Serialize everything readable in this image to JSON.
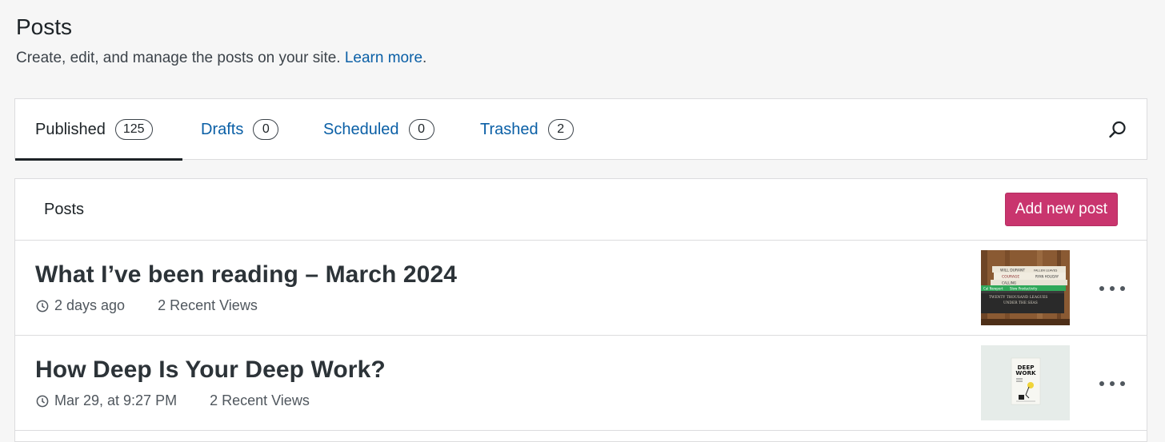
{
  "header": {
    "title": "Posts",
    "subtitle": "Create, edit, and manage the posts on your site.",
    "learn_more": "Learn more",
    "period": "."
  },
  "tabs": [
    {
      "label": "Published",
      "count": "125",
      "active": true
    },
    {
      "label": "Drafts",
      "count": "0"
    },
    {
      "label": "Scheduled",
      "count": "0"
    },
    {
      "label": "Trashed",
      "count": "2"
    }
  ],
  "posts_list": {
    "header_label": "Posts",
    "add_button": "Add new post",
    "items": [
      {
        "title": "What I’ve been reading – March 2024",
        "date": "2 days ago",
        "views": "2 Recent Views",
        "thumbnail": "book-stack-image"
      },
      {
        "title": "How Deep Is Your Deep Work?",
        "date": "Mar 29, at 9:27 PM",
        "views": "2 Recent Views",
        "thumbnail": "deep-work-book-cover"
      }
    ]
  },
  "thumbnails": {
    "book1": "WILL DURANT",
    "book1b": "FALLEN LEAVES",
    "book2a": "COURAGE",
    "book2b": "CALLING",
    "book2c": "RYAN HOLIDAY",
    "book3a": "Cal Newport",
    "book3b": "Slow Productivity",
    "book4a": "TWENTY THOUSAND LEAGUES",
    "book4b": "UNDER THE SEAS",
    "cover_line1": "DEEP",
    "cover_line2": "WORK"
  },
  "colors": {
    "accent": "#c9356e",
    "link": "#0a5fa6",
    "text": "#1d2327"
  }
}
